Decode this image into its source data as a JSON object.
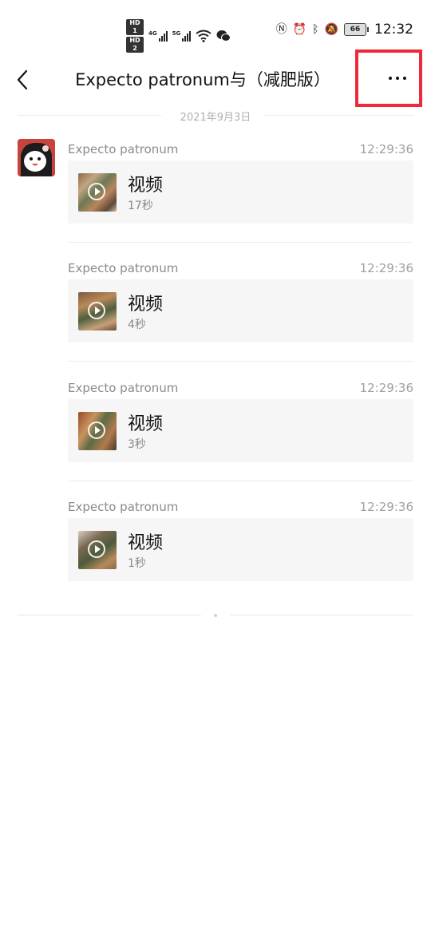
{
  "status_bar": {
    "hd1": "HD 1",
    "hd2": "HD 2",
    "net1": "4G",
    "net2": "5G",
    "battery": "66",
    "time": "12:32"
  },
  "header": {
    "title": "Expecto patronum与（减肥版）"
  },
  "date_separator": "2021年9月3日",
  "messages": [
    {
      "sender": "Expecto patronum",
      "time": "12:29:36",
      "type_label": "视频",
      "duration": "17秒"
    },
    {
      "sender": "Expecto patronum",
      "time": "12:29:36",
      "type_label": "视频",
      "duration": "4秒"
    },
    {
      "sender": "Expecto patronum",
      "time": "12:29:36",
      "type_label": "视频",
      "duration": "3秒"
    },
    {
      "sender": "Expecto patronum",
      "time": "12:29:36",
      "type_label": "视频",
      "duration": "1秒"
    }
  ],
  "colors": {
    "highlight_box": "#ee2a3a",
    "card_bg": "#f6f6f6",
    "meta_text": "#8a8a8a"
  }
}
